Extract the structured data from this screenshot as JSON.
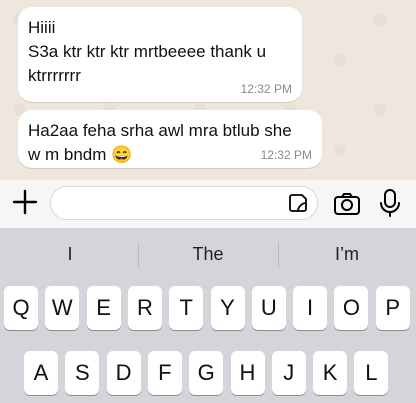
{
  "messages": [
    {
      "text": "Hiiii\nS3a ktr ktr ktr mrtbeeee thank u\nktrrrrrrr",
      "time": "12:32 PM"
    },
    {
      "text": "Ha2aa feha srha awl mra btlub she\nw m bndm 😄",
      "time": "12:32 PM"
    }
  ],
  "composer": {
    "placeholder": "",
    "icons": [
      "plus-icon",
      "sticker-icon",
      "camera-icon",
      "microphone-icon"
    ]
  },
  "keyboard": {
    "suggestions": [
      "I",
      "The",
      "I’m"
    ],
    "row1": [
      "Q",
      "W",
      "E",
      "R",
      "T",
      "Y",
      "U",
      "I",
      "O",
      "P"
    ],
    "row2": [
      "A",
      "S",
      "D",
      "F",
      "G",
      "H",
      "J",
      "K",
      "L"
    ]
  }
}
